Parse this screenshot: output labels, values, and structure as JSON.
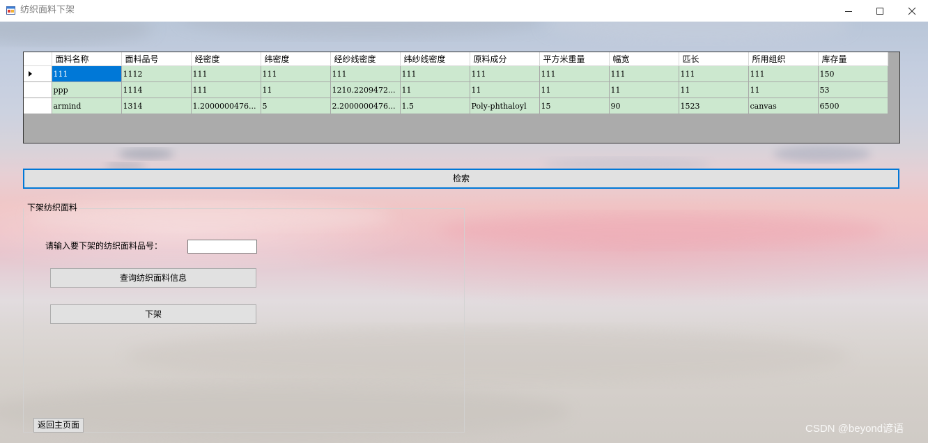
{
  "window": {
    "title": "纺织面料下架"
  },
  "grid": {
    "columns": [
      "面料名称",
      "面料品号",
      "经密度",
      "纬密度",
      "经纱线密度",
      "纬纱线密度",
      "原料成分",
      "平方米重量",
      "幅宽",
      "匹长",
      "所用组织",
      "库存量"
    ],
    "rows": [
      [
        "111",
        "1112",
        "111",
        "111",
        "111",
        "111",
        "111",
        "111",
        "111",
        "111",
        "111",
        "150"
      ],
      [
        "ppp",
        "1114",
        "111",
        "11",
        "1210.2209472...",
        "11",
        "11",
        "11",
        "11",
        "11",
        "11",
        "53"
      ],
      [
        "armind",
        "1314",
        "1.2000000476...",
        "5",
        "2.2000000476...",
        "1.5",
        "Poly-phthaloyl",
        "15",
        "90",
        "1523",
        "canvas",
        "6500"
      ]
    ]
  },
  "search_button": "检索",
  "groupbox": {
    "title": "下架纺织面料",
    "prompt_label": "请输入要下架的纺织面料品号：",
    "input_value": "",
    "query_button": "查询纺织面料信息",
    "offshelf_button": "下架"
  },
  "home_button": "返回主页面",
  "watermark": "CSDN @beyond谚语"
}
